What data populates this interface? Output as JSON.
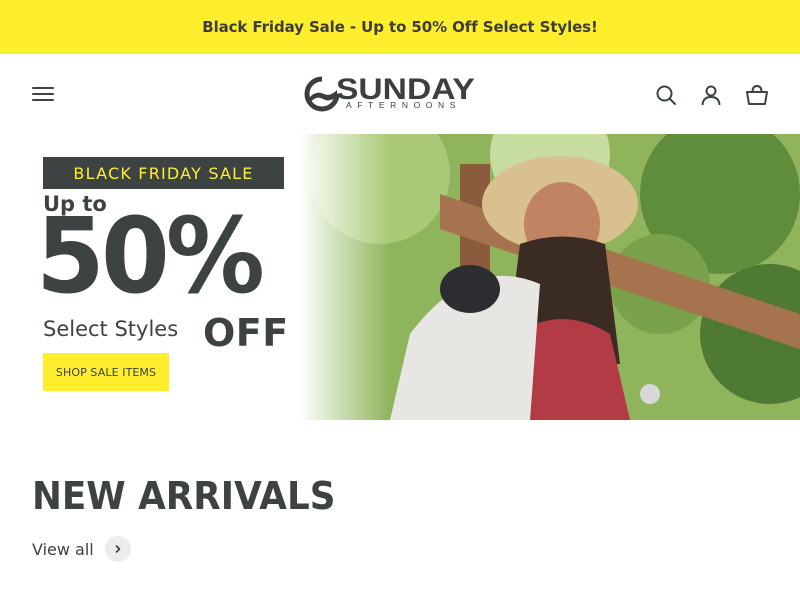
{
  "announcement": {
    "text": "Black Friday Sale - Up to 50% Off Select Styles!",
    "background": "#ffee2e"
  },
  "header": {
    "logo": {
      "word": "SUNDAY",
      "sub": "AFTERNOONS"
    },
    "icons": [
      "menu-icon",
      "search-icon",
      "account-icon",
      "cart-icon"
    ]
  },
  "hero": {
    "banner": "BLACK FRIDAY SALE",
    "up_to": "Up to",
    "percent": "50%",
    "select_styles": "Select Styles",
    "off": "OFF",
    "cta": "SHOP SALE ITEMS",
    "colors": {
      "dark": "#3d4242",
      "accent": "#ffee2e"
    }
  },
  "new_arrivals": {
    "title": "NEW ARRIVALS",
    "view_all": "View all"
  }
}
